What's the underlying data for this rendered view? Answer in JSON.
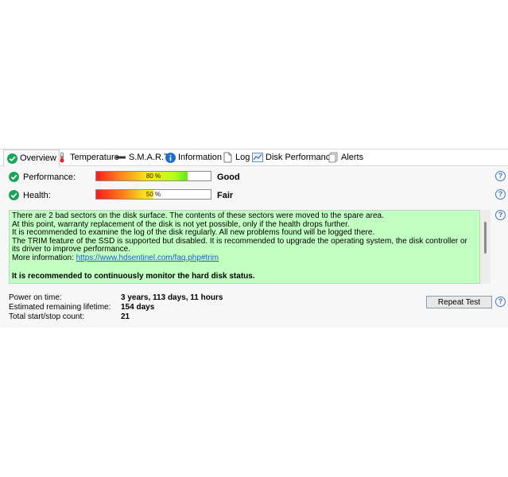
{
  "tabs": [
    {
      "label": "Overview",
      "icon": "check-circle-icon"
    },
    {
      "label": "Temperature",
      "icon": "thermometer-icon"
    },
    {
      "label": "S.M.A.R.T.",
      "icon": "dash-icon"
    },
    {
      "label": "Information",
      "icon": "info-icon"
    },
    {
      "label": "Log",
      "icon": "document-icon"
    },
    {
      "label": "Disk Performance",
      "icon": "chart-icon"
    },
    {
      "label": "Alerts",
      "icon": "alerts-icon"
    }
  ],
  "performance": {
    "label": "Performance:",
    "percent_text": "80 %",
    "value": 80,
    "status": "Good"
  },
  "health": {
    "label": "Health:",
    "percent_text": "50 %",
    "value": 50,
    "status": "Fair"
  },
  "message": {
    "lines": [
      "There are 2 bad sectors on the disk surface. The contents of these sectors were moved to the spare area.",
      "At this point, warranty replacement of the disk is not yet possible, only if the health drops further.",
      "It is recommended to examine the log of the disk regularly. All new problems found will be logged there.",
      "The TRIM feature of the SSD is supported but disabled. It is recommended to upgrade the operating system, the disk controller or its driver to improve performance."
    ],
    "more_info_label": "More information: ",
    "link": "https://www.hdsentinel.com/faq.php#trim",
    "recommendation": "It is recommended to continuously monitor the hard disk status."
  },
  "stats": [
    {
      "label": "Power on time:",
      "value": "3 years, 113 days, 11 hours"
    },
    {
      "label": "Estimated remaining lifetime:",
      "value": "154 days"
    },
    {
      "label": "Total start/stop count:",
      "value": "21"
    }
  ],
  "repeat_test_label": "Repeat Test",
  "help_glyph": "?",
  "colors": {
    "message_bg": "#c2ffc2",
    "check": "#1aa35a",
    "link": "#1f5fc0"
  }
}
